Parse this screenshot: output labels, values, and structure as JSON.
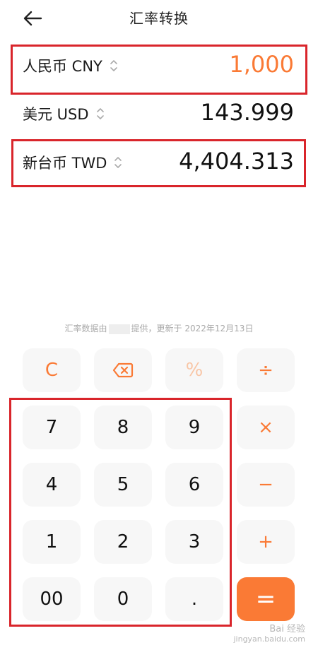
{
  "header": {
    "title": "汇率转换",
    "back_icon": "back-arrow-icon"
  },
  "rows": [
    {
      "currency": "人民币 CNY",
      "amount": "1,000",
      "active": true
    },
    {
      "currency": "美元 USD",
      "amount": "143.999",
      "active": false
    },
    {
      "currency": "新台币 TWD",
      "amount": "4,404.313",
      "active": false
    }
  ],
  "note": {
    "prefix": "汇率数据由",
    "suffix": "提供，更新于 2022年12月13日"
  },
  "keypad": {
    "clear": "C",
    "backspace_icon": "backspace-icon",
    "percent": "%",
    "divide": "÷",
    "multiply": "×",
    "minus": "−",
    "plus": "+",
    "equals": "=",
    "digits": {
      "k7": "7",
      "k8": "8",
      "k9": "9",
      "k4": "4",
      "k5": "5",
      "k6": "6",
      "k1": "1",
      "k2": "2",
      "k3": "3",
      "k00": "00",
      "k0": "0",
      "kdot": "."
    }
  },
  "watermark": {
    "line1": "Bai 经验",
    "line2": "jingyan.baidu.com"
  },
  "colors": {
    "accent": "#fa7a35",
    "highlight_box": "#d9252b",
    "key_bg": "#f7f7f7"
  }
}
